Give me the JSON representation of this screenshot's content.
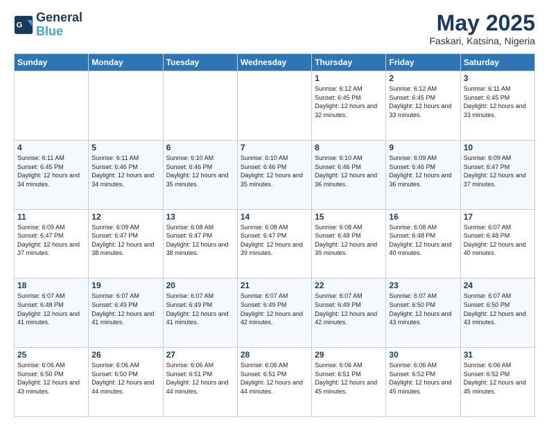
{
  "header": {
    "logo_line1": "General",
    "logo_line2": "Blue",
    "month": "May 2025",
    "location": "Faskari, Katsina, Nigeria"
  },
  "weekdays": [
    "Sunday",
    "Monday",
    "Tuesday",
    "Wednesday",
    "Thursday",
    "Friday",
    "Saturday"
  ],
  "weeks": [
    [
      {
        "day": "",
        "info": ""
      },
      {
        "day": "",
        "info": ""
      },
      {
        "day": "",
        "info": ""
      },
      {
        "day": "",
        "info": ""
      },
      {
        "day": "1",
        "info": "Sunrise: 6:12 AM\nSunset: 6:45 PM\nDaylight: 12 hours\nand 32 minutes."
      },
      {
        "day": "2",
        "info": "Sunrise: 6:12 AM\nSunset: 6:45 PM\nDaylight: 12 hours\nand 33 minutes."
      },
      {
        "day": "3",
        "info": "Sunrise: 6:11 AM\nSunset: 6:45 PM\nDaylight: 12 hours\nand 33 minutes."
      }
    ],
    [
      {
        "day": "4",
        "info": "Sunrise: 6:11 AM\nSunset: 6:45 PM\nDaylight: 12 hours\nand 34 minutes."
      },
      {
        "day": "5",
        "info": "Sunrise: 6:11 AM\nSunset: 6:46 PM\nDaylight: 12 hours\nand 34 minutes."
      },
      {
        "day": "6",
        "info": "Sunrise: 6:10 AM\nSunset: 6:46 PM\nDaylight: 12 hours\nand 35 minutes."
      },
      {
        "day": "7",
        "info": "Sunrise: 6:10 AM\nSunset: 6:46 PM\nDaylight: 12 hours\nand 35 minutes."
      },
      {
        "day": "8",
        "info": "Sunrise: 6:10 AM\nSunset: 6:46 PM\nDaylight: 12 hours\nand 36 minutes."
      },
      {
        "day": "9",
        "info": "Sunrise: 6:09 AM\nSunset: 6:46 PM\nDaylight: 12 hours\nand 36 minutes."
      },
      {
        "day": "10",
        "info": "Sunrise: 6:09 AM\nSunset: 6:47 PM\nDaylight: 12 hours\nand 37 minutes."
      }
    ],
    [
      {
        "day": "11",
        "info": "Sunrise: 6:09 AM\nSunset: 6:47 PM\nDaylight: 12 hours\nand 37 minutes."
      },
      {
        "day": "12",
        "info": "Sunrise: 6:09 AM\nSunset: 6:47 PM\nDaylight: 12 hours\nand 38 minutes."
      },
      {
        "day": "13",
        "info": "Sunrise: 6:08 AM\nSunset: 6:47 PM\nDaylight: 12 hours\nand 38 minutes."
      },
      {
        "day": "14",
        "info": "Sunrise: 6:08 AM\nSunset: 6:47 PM\nDaylight: 12 hours\nand 39 minutes."
      },
      {
        "day": "15",
        "info": "Sunrise: 6:08 AM\nSunset: 6:48 PM\nDaylight: 12 hours\nand 39 minutes."
      },
      {
        "day": "16",
        "info": "Sunrise: 6:08 AM\nSunset: 6:48 PM\nDaylight: 12 hours\nand 40 minutes."
      },
      {
        "day": "17",
        "info": "Sunrise: 6:07 AM\nSunset: 6:48 PM\nDaylight: 12 hours\nand 40 minutes."
      }
    ],
    [
      {
        "day": "18",
        "info": "Sunrise: 6:07 AM\nSunset: 6:48 PM\nDaylight: 12 hours\nand 41 minutes."
      },
      {
        "day": "19",
        "info": "Sunrise: 6:07 AM\nSunset: 6:49 PM\nDaylight: 12 hours\nand 41 minutes."
      },
      {
        "day": "20",
        "info": "Sunrise: 6:07 AM\nSunset: 6:49 PM\nDaylight: 12 hours\nand 41 minutes."
      },
      {
        "day": "21",
        "info": "Sunrise: 6:07 AM\nSunset: 6:49 PM\nDaylight: 12 hours\nand 42 minutes."
      },
      {
        "day": "22",
        "info": "Sunrise: 6:07 AM\nSunset: 6:49 PM\nDaylight: 12 hours\nand 42 minutes."
      },
      {
        "day": "23",
        "info": "Sunrise: 6:07 AM\nSunset: 6:50 PM\nDaylight: 12 hours\nand 43 minutes."
      },
      {
        "day": "24",
        "info": "Sunrise: 6:07 AM\nSunset: 6:50 PM\nDaylight: 12 hours\nand 43 minutes."
      }
    ],
    [
      {
        "day": "25",
        "info": "Sunrise: 6:06 AM\nSunset: 6:50 PM\nDaylight: 12 hours\nand 43 minutes."
      },
      {
        "day": "26",
        "info": "Sunrise: 6:06 AM\nSunset: 6:50 PM\nDaylight: 12 hours\nand 44 minutes."
      },
      {
        "day": "27",
        "info": "Sunrise: 6:06 AM\nSunset: 6:51 PM\nDaylight: 12 hours\nand 44 minutes."
      },
      {
        "day": "28",
        "info": "Sunrise: 6:06 AM\nSunset: 6:51 PM\nDaylight: 12 hours\nand 44 minutes."
      },
      {
        "day": "29",
        "info": "Sunrise: 6:06 AM\nSunset: 6:51 PM\nDaylight: 12 hours\nand 45 minutes."
      },
      {
        "day": "30",
        "info": "Sunrise: 6:06 AM\nSunset: 6:52 PM\nDaylight: 12 hours\nand 45 minutes."
      },
      {
        "day": "31",
        "info": "Sunrise: 6:06 AM\nSunset: 6:52 PM\nDaylight: 12 hours\nand 45 minutes."
      }
    ]
  ]
}
